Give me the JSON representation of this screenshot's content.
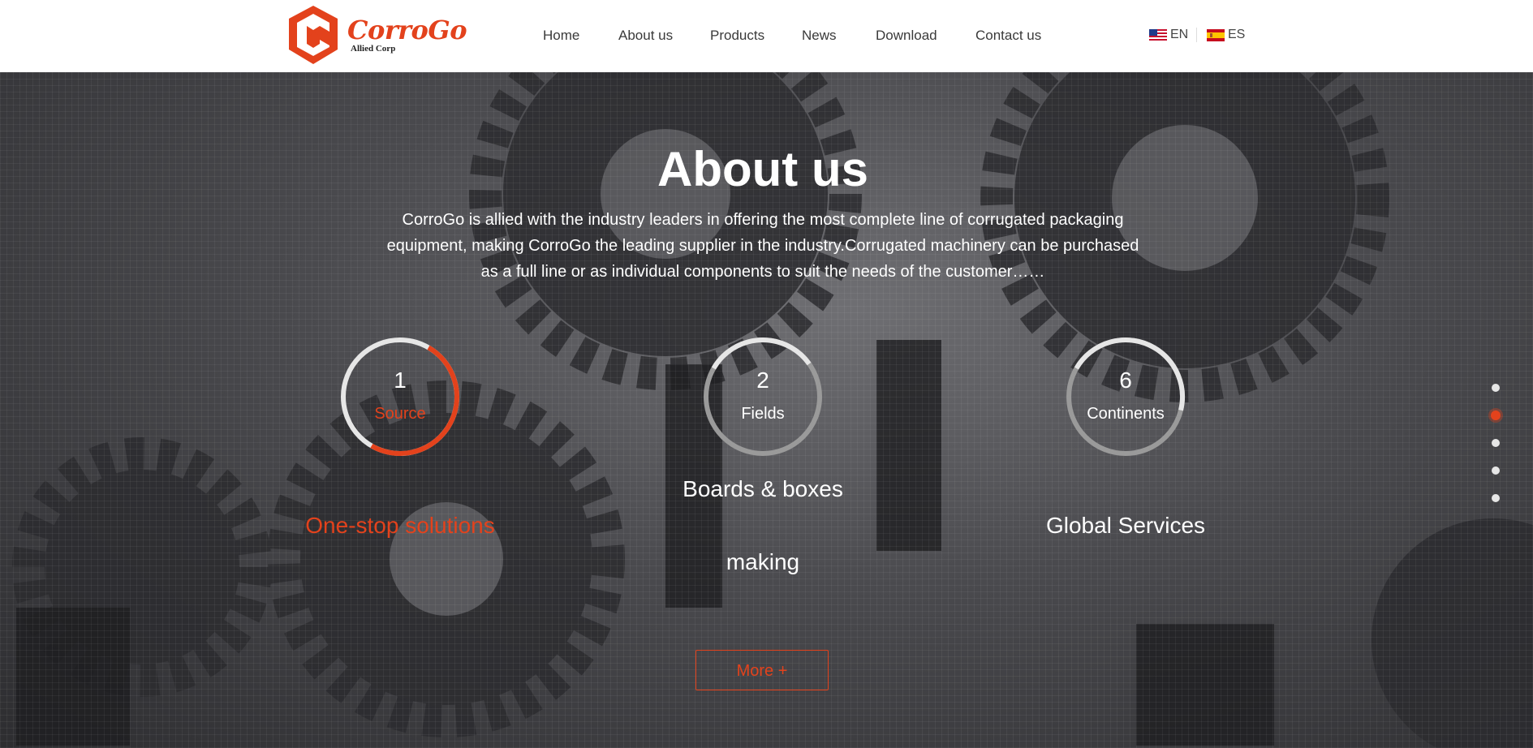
{
  "header": {
    "brand": "CorroGo",
    "tagline": "Allied Corp",
    "nav": [
      "Home",
      "About us",
      "Products",
      "News",
      "Download",
      "Contact us"
    ],
    "languages": [
      {
        "code": "EN",
        "flag": "us-flag-icon"
      },
      {
        "code": "ES",
        "flag": "es-flag-icon"
      }
    ]
  },
  "hero": {
    "title": "About us",
    "description": "CorroGo is allied with the industry leaders in offering the most complete line of corrugated packaging equipment, making CorroGo the leading supplier in the industry.Corrugated machinery can be purchased as a full line or as individual components to suit the needs of the customer……",
    "stats": [
      {
        "number": "1",
        "label": "Source",
        "caption": "One-stop solutions",
        "active": true
      },
      {
        "number": "2",
        "label": "Fields",
        "caption_line1": "Boards & boxes",
        "caption_line2": "making",
        "active": false
      },
      {
        "number": "6",
        "label": "Continents",
        "caption": "Global Services",
        "active": false
      }
    ],
    "more_label": "More +",
    "pagination": {
      "total": 5,
      "active_index": 2
    }
  },
  "colors": {
    "accent": "#e3421c",
    "ring": "#e6e6e6",
    "ring_muted": "#9a9a9a",
    "header_bg": "#ffffff"
  }
}
